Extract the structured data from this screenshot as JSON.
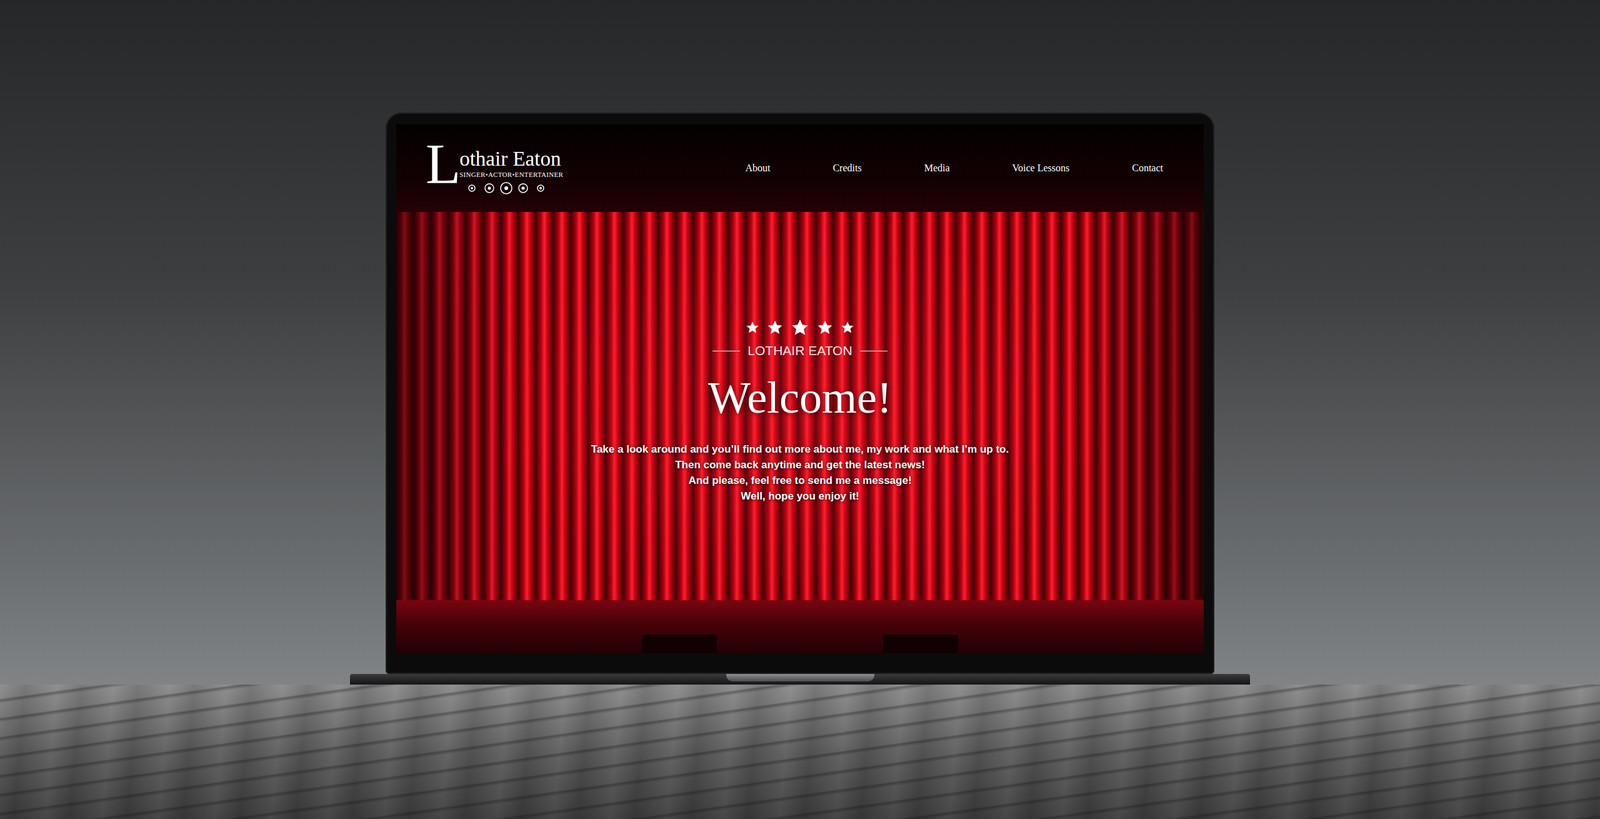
{
  "site": {
    "logo": {
      "initial": "L",
      "name": "othair Eaton",
      "tagline": "SINGER•ACTOR•ENTERTAINER"
    },
    "nav": [
      {
        "label": "About"
      },
      {
        "label": "Credits"
      },
      {
        "label": "Media"
      },
      {
        "label": "Voice Lessons"
      },
      {
        "label": "Contact"
      }
    ]
  },
  "hero": {
    "stars": 5,
    "eyebrow": "LOTHAIR EATON",
    "title": "Welcome!",
    "lines": [
      "Take a look around and you’ll find out more about me, my work and what I’m up to.",
      "Then come back anytime and get the latest news!",
      "And please, feel free to send me a message!",
      "Well, hope you enjoy it!"
    ]
  }
}
